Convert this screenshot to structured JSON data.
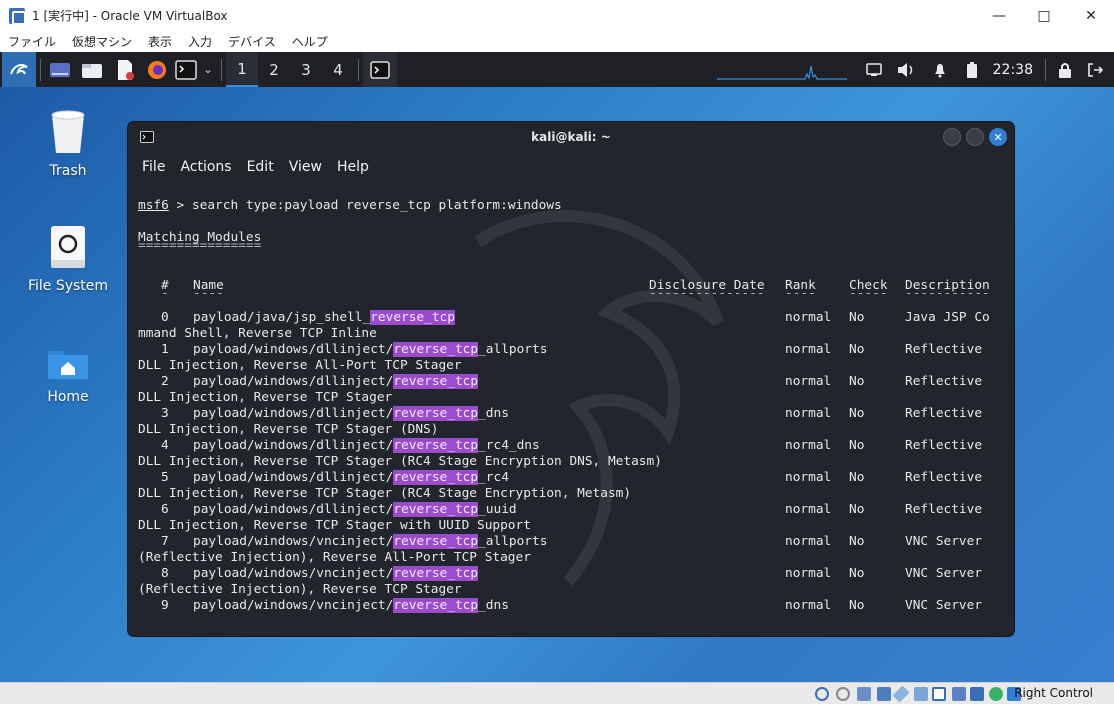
{
  "host": {
    "title": "1 [実行中] - Oracle VM VirtualBox",
    "menu": [
      "ファイル",
      "仮想マシン",
      "表示",
      "入力",
      "デバイス",
      "ヘルプ"
    ],
    "right_control": "Right Control"
  },
  "panel": {
    "workspaces": [
      "1",
      "2",
      "3",
      "4"
    ],
    "active_workspace": "1",
    "clock": "22:38"
  },
  "desktop": {
    "icons": [
      {
        "label": "Trash",
        "icon": "trash-icon"
      },
      {
        "label": "File System",
        "icon": "drive-icon"
      },
      {
        "label": "Home",
        "icon": "home-folder-icon"
      }
    ]
  },
  "terminal": {
    "title": "kali@kali: ~",
    "menu": [
      "File",
      "Actions",
      "Edit",
      "View",
      "Help"
    ],
    "prompt": "msf6",
    "command": " > search type:payload reverse_tcp platform:windows",
    "heading": "Matching Modules",
    "heading_rule": "================",
    "columns": {
      "num": "#",
      "name": "Name",
      "date": "Disclosure Date",
      "rank": "Rank",
      "check": "Check",
      "desc": "Description"
    },
    "rules": {
      "num": "-",
      "name": "----",
      "date": "---------------",
      "rank": "----",
      "check": "-----",
      "desc": "-----------"
    },
    "rows": [
      {
        "num": "0",
        "pre": "payload/java/jsp_shell_",
        "hl": "reverse_tcp",
        "post": "",
        "rank": "normal",
        "check": "No",
        "desc": "Java JSP Co",
        "wrap": "mmand Shell, Reverse TCP Inline"
      },
      {
        "num": "1",
        "pre": "payload/windows/dllinject/",
        "hl": "reverse_tcp",
        "post": "_allports",
        "rank": "normal",
        "check": "No",
        "desc": "Reflective",
        "wrap": "DLL Injection, Reverse All-Port TCP Stager"
      },
      {
        "num": "2",
        "pre": "payload/windows/dllinject/",
        "hl": "reverse_tcp",
        "post": "",
        "rank": "normal",
        "check": "No",
        "desc": "Reflective",
        "wrap": "DLL Injection, Reverse TCP Stager"
      },
      {
        "num": "3",
        "pre": "payload/windows/dllinject/",
        "hl": "reverse_tcp",
        "post": "_dns",
        "rank": "normal",
        "check": "No",
        "desc": "Reflective",
        "wrap": "DLL Injection, Reverse TCP Stager (DNS)"
      },
      {
        "num": "4",
        "pre": "payload/windows/dllinject/",
        "hl": "reverse_tcp",
        "post": "_rc4_dns",
        "rank": "normal",
        "check": "No",
        "desc": "Reflective",
        "wrap": "DLL Injection, Reverse TCP Stager (RC4 Stage Encryption DNS, Metasm)"
      },
      {
        "num": "5",
        "pre": "payload/windows/dllinject/",
        "hl": "reverse_tcp",
        "post": "_rc4",
        "rank": "normal",
        "check": "No",
        "desc": "Reflective",
        "wrap": "DLL Injection, Reverse TCP Stager (RC4 Stage Encryption, Metasm)"
      },
      {
        "num": "6",
        "pre": "payload/windows/dllinject/",
        "hl": "reverse_tcp",
        "post": "_uuid",
        "rank": "normal",
        "check": "No",
        "desc": "Reflective",
        "wrap": "DLL Injection, Reverse TCP Stager with UUID Support"
      },
      {
        "num": "7",
        "pre": "payload/windows/vncinject/",
        "hl": "reverse_tcp",
        "post": "_allports",
        "rank": "normal",
        "check": "No",
        "desc": "VNC Server",
        "wrap": "(Reflective Injection), Reverse All-Port TCP Stager"
      },
      {
        "num": "8",
        "pre": "payload/windows/vncinject/",
        "hl": "reverse_tcp",
        "post": "",
        "rank": "normal",
        "check": "No",
        "desc": "VNC Server",
        "wrap": "(Reflective Injection), Reverse TCP Stager"
      },
      {
        "num": "9",
        "pre": "payload/windows/vncinject/",
        "hl": "reverse_tcp",
        "post": "_dns",
        "rank": "normal",
        "check": "No",
        "desc": "VNC Server",
        "wrap": ""
      }
    ]
  },
  "colors": {
    "highlight": "#9a4ccf",
    "terminal_bg": "#22252c",
    "panel_bg": "#1e2026",
    "close_button": "#2f7fd6"
  }
}
